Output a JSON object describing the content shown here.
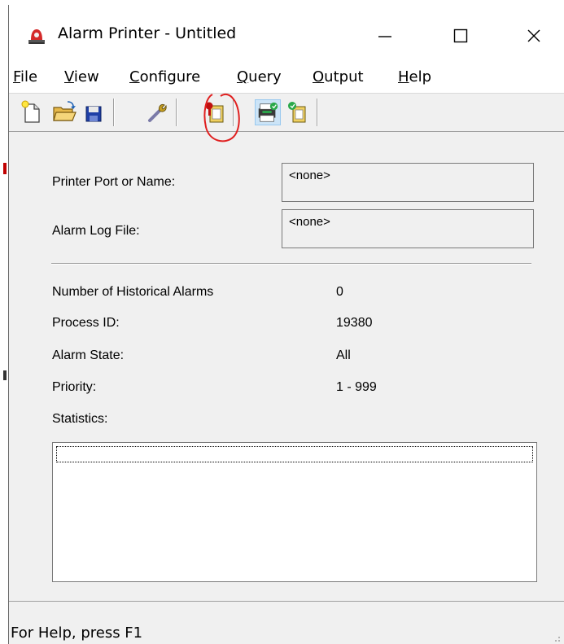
{
  "window": {
    "title": "Alarm Printer - Untitled",
    "icon": "alarm-bell-icon",
    "controls": [
      "minimize-icon",
      "maximize-icon",
      "close-icon"
    ]
  },
  "menu": [
    {
      "underline": "F",
      "rest": "ile"
    },
    {
      "underline": "V",
      "rest": "iew"
    },
    {
      "underline": "C",
      "rest": "onfigure"
    },
    {
      "underline": "Q",
      "rest": "uery"
    },
    {
      "underline": "O",
      "rest": "utput"
    },
    {
      "underline": "H",
      "rest": "elp"
    }
  ],
  "toolbar": {
    "buttons": [
      "new-file-icon",
      "open-folder-icon",
      "save-disk-icon",
      "configure-wrench-icon",
      "query-alarm-icon",
      "output-printer-icon",
      "output-file-icon"
    ],
    "pressed": "output-printer-icon",
    "annotation_color": "#e02020"
  },
  "form": {
    "printer_label": "Printer Port or Name:",
    "printer_value": "<none>",
    "logfile_label": "Alarm Log File:",
    "logfile_value": "<none>"
  },
  "info": {
    "historical_label": "Number of Historical Alarms",
    "historical_value": "0",
    "pid_label": "Process ID:",
    "pid_value": "19380",
    "state_label": "Alarm State:",
    "state_value": "All",
    "priority_label": "Priority:",
    "priority_value": "1 - 999",
    "statistics_label": "Statistics:"
  },
  "status": {
    "text": "For Help, press F1"
  }
}
